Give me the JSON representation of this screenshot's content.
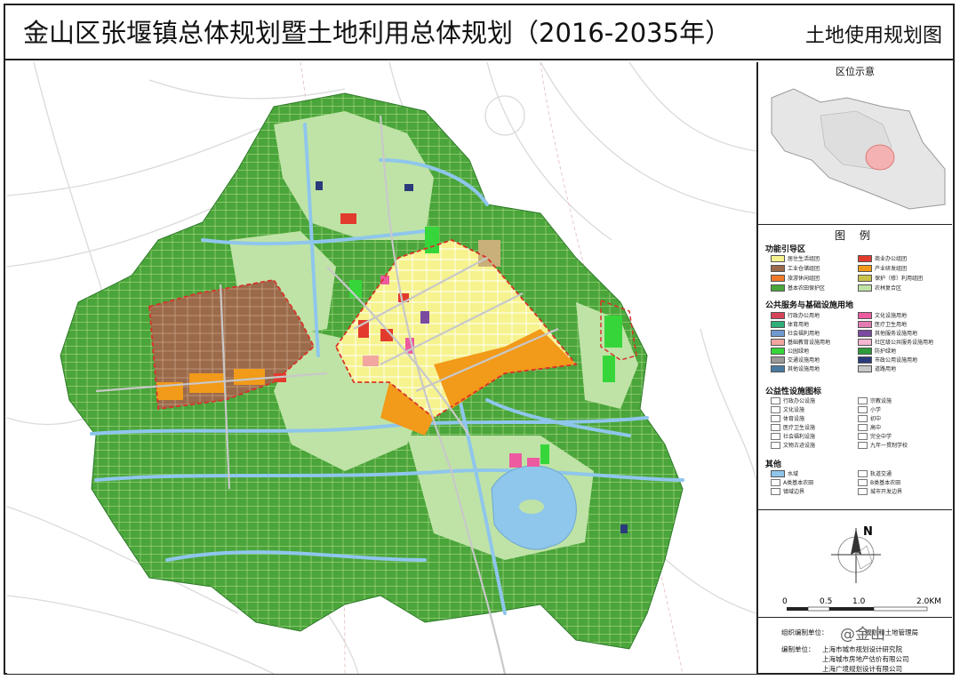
{
  "header": {
    "title": "金山区张堰镇总体规划暨土地利用总体规划（2016-2035年）",
    "subtitle": "土地使用规划图"
  },
  "location_panel": {
    "title": "区位示意"
  },
  "legend": {
    "title": "图 例",
    "sections": [
      {
        "title": "功能引导区",
        "items": [
          {
            "label": "居住生活组团",
            "color": "#f6f38e"
          },
          {
            "label": "商业办公组团",
            "color": "#e23b2e"
          },
          {
            "label": "工业仓储组团",
            "color": "#9b6a4a"
          },
          {
            "label": "产业研发组团",
            "color": "#f29a1a"
          },
          {
            "label": "旅游休闲组团",
            "color": "#f07a2a"
          },
          {
            "label": "保护（修）利用组团",
            "color": "#c9c24a"
          },
          {
            "label": "基本农田保护区",
            "color": "#4aa53a"
          },
          {
            "label": "农林复合区",
            "color": "#bfe3a6"
          }
        ]
      },
      {
        "title": "公共服务与基础设施用地",
        "items": [
          {
            "label": "行政办公用地",
            "color": "#d6455a"
          },
          {
            "label": "文化设施用地",
            "color": "#ec5aa0"
          },
          {
            "label": "体育用地",
            "color": "#2fae7a"
          },
          {
            "label": "医疗卫生用地",
            "color": "#e37ab0"
          },
          {
            "label": "社会福利用地",
            "color": "#6f9ad0"
          },
          {
            "label": "其他服务设施用地",
            "color": "#7a4aa0"
          },
          {
            "label": "基础教育设施用地",
            "color": "#f2a6a0"
          },
          {
            "label": "社区级公共服务设施用地",
            "color": "#f4b6d0"
          },
          {
            "label": "公园绿地",
            "color": "#36d63a"
          },
          {
            "label": "防护绿地",
            "color": "#2f9a3a"
          },
          {
            "label": "交通设施用地",
            "color": "#9a9a9a"
          },
          {
            "label": "市政公用设施用地",
            "color": "#2a3a7a"
          },
          {
            "label": "其他设施用地",
            "color": "#4a7aa0"
          },
          {
            "label": "道路用地",
            "color": "#c8c8c8"
          }
        ]
      },
      {
        "title": "公益性设施图标",
        "items": [
          {
            "label": "行政办公设施"
          },
          {
            "label": "宗教设施"
          },
          {
            "label": "文化设施"
          },
          {
            "label": "小学"
          },
          {
            "label": "体育设施"
          },
          {
            "label": "初中"
          },
          {
            "label": "医疗卫生设施"
          },
          {
            "label": "高中"
          },
          {
            "label": "社会福利设施"
          },
          {
            "label": "完全中学"
          },
          {
            "label": "文物古迹设施"
          },
          {
            "label": "九年一贯制学校"
          }
        ]
      },
      {
        "title": "其他",
        "items": [
          {
            "label": "水域",
            "color": "#8fc6ec"
          },
          {
            "label": "轨道交通"
          },
          {
            "label": "A类基本农田"
          },
          {
            "label": "B类基本农田"
          },
          {
            "label": "镇域边界"
          },
          {
            "label": "城市开发边界"
          }
        ]
      }
    ]
  },
  "scale_bar": {
    "labels": [
      "0",
      "0.5",
      "1.0",
      "2.0KM"
    ]
  },
  "north_arrow": "N",
  "credits": {
    "org_label": "组织编制单位：",
    "org_value": "规划和土地管理局",
    "watermark": "@金山",
    "editor_label": "编制单位：",
    "editors": [
      "上海市城市规划设计研究院",
      "上海城市房地产估价有限公司",
      "上海广境规划设计有限公司"
    ]
  },
  "map": {
    "colors": {
      "farmland": "#4aa53a",
      "farm_light": "#bfe3a6",
      "water": "#8fc6ec",
      "residential": "#f6f38e",
      "industrial": "#9b6a4a",
      "research": "#f29a1a",
      "commercial": "#e23b2e",
      "park": "#36d63a",
      "boundary": "#d8322a"
    }
  }
}
